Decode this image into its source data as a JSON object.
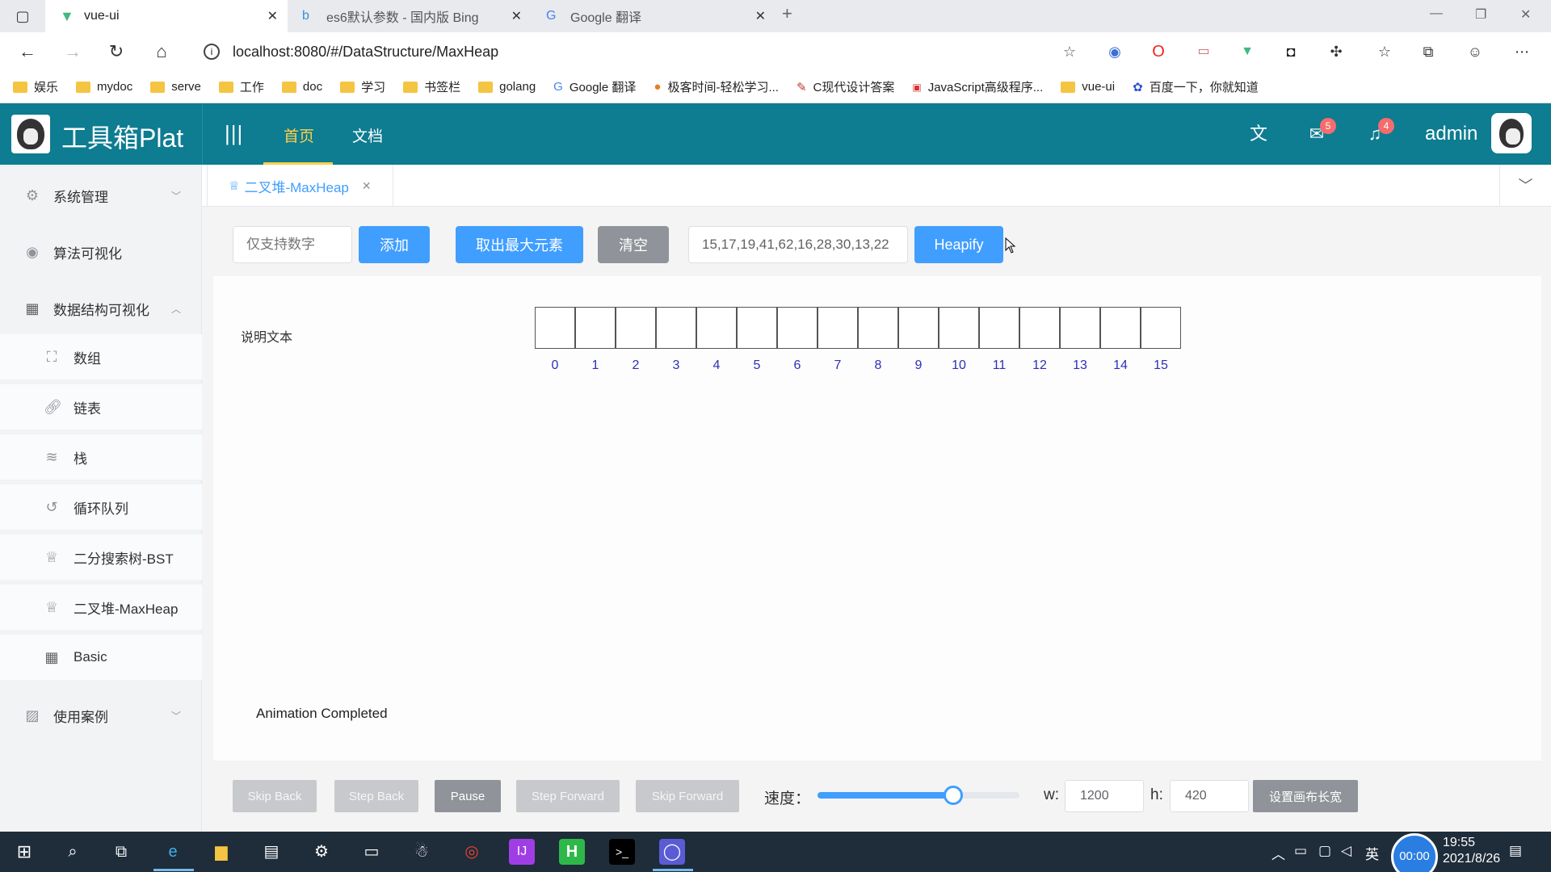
{
  "browser": {
    "tabs": [
      {
        "title": "vue-ui",
        "active": true
      },
      {
        "title": "es6默认参数 - 国内版 Bing",
        "active": false
      },
      {
        "title": "Google 翻译",
        "active": false
      }
    ],
    "url": "localhost:8080/#/DataStructure/MaxHeap",
    "bookmarks": [
      "娱乐",
      "mydoc",
      "serve",
      "工作",
      "doc",
      "学习",
      "书签栏",
      "golang",
      "Google 翻译",
      "极客时间-轻松学习...",
      "C现代设计答案",
      "JavaScript高级程序...",
      "vue-ui",
      "百度一下，你就知道"
    ]
  },
  "header": {
    "logo_text": "工具箱Plat",
    "nav": [
      {
        "label": "首页",
        "active": true
      },
      {
        "label": "文档",
        "active": false
      }
    ],
    "mail_badge": "5",
    "bell_badge": "4",
    "username": "admin"
  },
  "sidebar": {
    "items": [
      {
        "label": "系统管理",
        "icon": "gear-icon"
      },
      {
        "label": "算法可视化",
        "icon": "eye-icon"
      },
      {
        "label": "数据结构可视化",
        "icon": "grid-icon"
      },
      {
        "label": "使用案例",
        "icon": "picture-icon"
      }
    ],
    "sub_items": [
      {
        "label": "数组",
        "icon": "fullscreen-icon"
      },
      {
        "label": "链表",
        "icon": "link-icon"
      },
      {
        "label": "栈",
        "icon": "database-icon"
      },
      {
        "label": "循环队列",
        "icon": "refresh-icon"
      },
      {
        "label": "二分搜索树-BST",
        "icon": "trophy-icon"
      },
      {
        "label": "二叉堆-MaxHeap",
        "icon": "trophy-icon"
      },
      {
        "label": "Basic",
        "icon": "grid-icon"
      }
    ]
  },
  "tags_view": {
    "active_tag": "二叉堆-MaxHeap"
  },
  "controls": {
    "number_placeholder": "仅支持数字",
    "add_label": "添加",
    "extract_max_label": "取出最大元素",
    "clear_label": "清空",
    "heapify_value": "15,17,19,41,62,16,28,30,13,22",
    "heapify_label": "Heapify"
  },
  "canvas": {
    "description": "说明文本",
    "indices": [
      "0",
      "1",
      "2",
      "3",
      "4",
      "5",
      "6",
      "7",
      "8",
      "9",
      "10",
      "11",
      "12",
      "13",
      "14",
      "15"
    ],
    "status": "Animation Completed"
  },
  "playback": {
    "skip_back": "Skip Back",
    "step_back": "Step Back",
    "pause": "Pause",
    "step_forward": "Step Forward",
    "skip_forward": "Skip Forward",
    "speed_label": "速度：",
    "speed_fraction": 0.67,
    "w_label": "w:",
    "w_value": "1200",
    "h_label": "h:",
    "h_value": "420",
    "set_size_label": "设置画布长宽"
  },
  "taskbar": {
    "recording": "00:00",
    "time": "19:55",
    "date": "2021/8/26",
    "ime": "英"
  },
  "colors": {
    "header_bg": "#0e7c91",
    "primary": "#409eff",
    "active_nav": "#ffd04b",
    "badge": "#f56c6c"
  }
}
